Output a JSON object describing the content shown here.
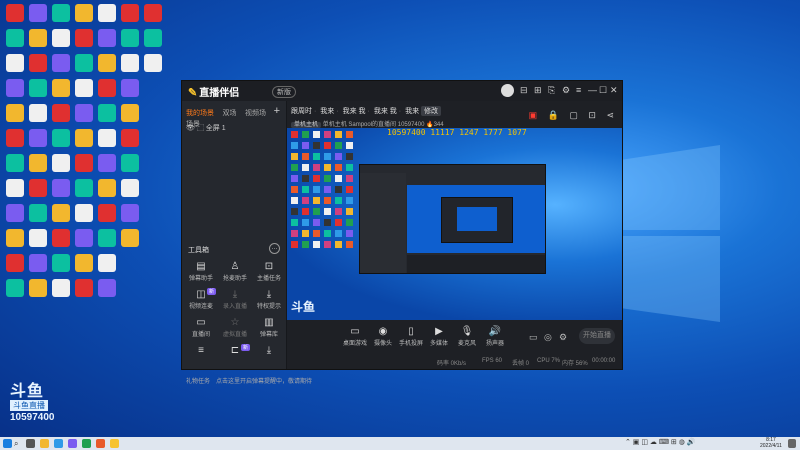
{
  "colors": {
    "accent": "#ff7a1a",
    "desktop_blue": "#0d4fb5",
    "app_bg": "#22252b",
    "scroll_text": "#f5c400"
  },
  "watermark": {
    "logo": "斗鱼",
    "sub": "斗鱼直播",
    "room_id": "10597400"
  },
  "app": {
    "logo_text": "直播伴侣",
    "version_tag": "新版",
    "window_controls": [
      "⊟",
      "⊞",
      "⎘",
      "⚙",
      "≡",
      "—",
      "☐",
      "✕"
    ],
    "left_panel": {
      "tabs": [
        "我的场景",
        "双场",
        "视频场",
        "场景"
      ],
      "add_icon": "plus-icon",
      "scene": "全屏 1",
      "tools_title": "工具箱",
      "tools": [
        {
          "label": "弹幕助手",
          "icon": "chat-icon",
          "dim": false
        },
        {
          "label": "抢麦助手",
          "icon": "user-icon",
          "dim": false
        },
        {
          "label": "主播任务",
          "icon": "gift-icon",
          "dim": false
        },
        {
          "label": "视频连麦",
          "icon": "video-icon",
          "dim": false,
          "badge": "新"
        },
        {
          "label": "录入直播",
          "icon": "download-icon",
          "dim": true
        },
        {
          "label": "特权提示",
          "icon": "download-icon",
          "dim": false
        },
        {
          "label": "直播间",
          "icon": "monitor-icon",
          "dim": false
        },
        {
          "label": "虚拟直播",
          "icon": "star-icon",
          "dim": true
        },
        {
          "label": "弹幕库",
          "icon": "trash-icon",
          "dim": false
        },
        {
          "label": "",
          "icon": "list-icon",
          "dim": false
        },
        {
          "label": "",
          "icon": "cast-icon",
          "dim": false,
          "badge": "新"
        },
        {
          "label": "",
          "icon": "download-icon",
          "dim": false
        }
      ],
      "bottom_task": "礼物任务",
      "bottom_notice": "点击这里开启弹幕提醒中，敬请期待"
    },
    "room": {
      "title_parts": [
        "跟周时",
        "我来",
        "我来 我",
        "我来 我",
        "我来"
      ],
      "edit_label": "修改",
      "category_tag": "单机主机",
      "category": "单机主机",
      "streamer": "Sampool的直播间",
      "room_id": "10597400",
      "hot": "344"
    },
    "preview": {
      "scroll_text": "10597400  11117  1247  1777  1077"
    },
    "controls": [
      {
        "label": "桌面游戏",
        "icon": "screen-icon"
      },
      {
        "label": "摄像头",
        "icon": "camera-icon"
      },
      {
        "label": "手机投屏",
        "icon": "phone-icon"
      },
      {
        "label": "多媒体",
        "icon": "media-icon"
      },
      {
        "label": "麦克风",
        "icon": "mic-icon"
      },
      {
        "label": "扬声器",
        "icon": "speaker-icon"
      }
    ],
    "start_live_label": "开始直播",
    "status": {
      "rate": "码率 0Kb/s",
      "fps": "FPS 60",
      "dropped": "丢帧 0",
      "cpu": "CPU 7%",
      "memory": "内存 56%",
      "time": "00:00:00"
    }
  },
  "taskbar": {
    "time": "8:17",
    "date": "2022/4/11"
  }
}
